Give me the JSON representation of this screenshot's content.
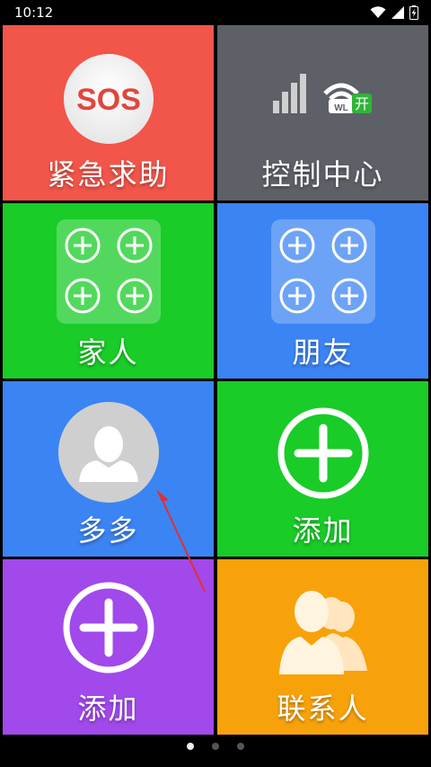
{
  "status_bar": {
    "time": "10:12"
  },
  "tiles": {
    "sos": {
      "label": "紧急求助",
      "icon_text": "SOS",
      "color": "#f2554a"
    },
    "control_center": {
      "label": "控制中心",
      "badge_wl": "WL",
      "badge_open": "开",
      "color": "#5e6068"
    },
    "family": {
      "label": "家人",
      "color": "#19cc27"
    },
    "friends": {
      "label": "朋友",
      "color": "#3b84f4"
    },
    "contact_duoduo": {
      "label": "多多",
      "color": "#3b84f4"
    },
    "add_green": {
      "label": "添加",
      "color": "#19cc27"
    },
    "add_purple": {
      "label": "添加",
      "color": "#a149ea"
    },
    "contacts": {
      "label": "联系人",
      "color": "#f8a20b"
    }
  },
  "pager": {
    "pages": 3,
    "active": 1
  }
}
